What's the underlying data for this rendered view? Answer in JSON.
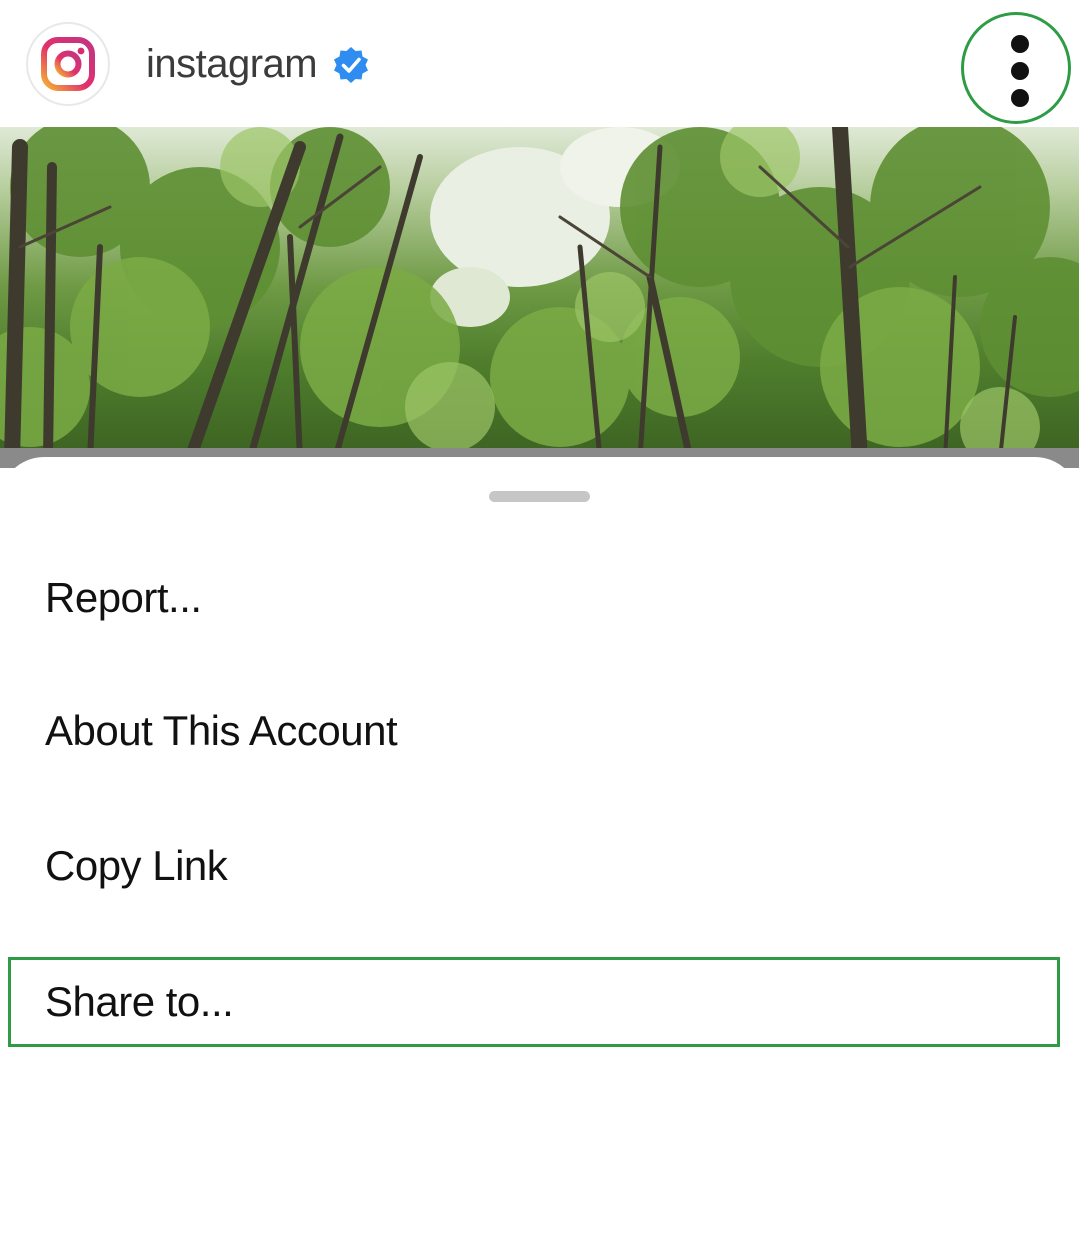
{
  "post_header": {
    "username": "instagram",
    "avatar_icon": "instagram-logo-icon",
    "verified_icon": "verified-badge-icon",
    "more_icon": "more-vertical-icon",
    "accent_color": "#2e9c45",
    "verified_color": "#2f8cf1"
  },
  "post_photo": {
    "image_icon": "forest-photo"
  },
  "sheet": {
    "grabber_icon": "drag-handle",
    "items": [
      {
        "label": "Report..."
      },
      {
        "label": "About This Account"
      },
      {
        "label": "Copy Link"
      },
      {
        "label": "Share to...",
        "highlighted": true
      }
    ]
  }
}
